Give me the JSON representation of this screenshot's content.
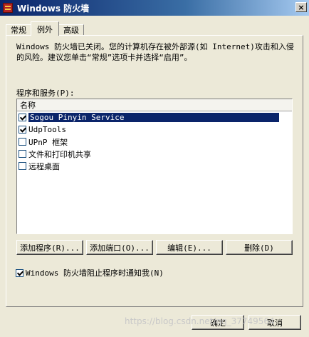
{
  "window": {
    "title": "Windows 防火墙",
    "close_glyph": "×"
  },
  "tabs": [
    {
      "label": "常规",
      "active": false
    },
    {
      "label": "例外",
      "active": true
    },
    {
      "label": "高级",
      "active": false
    }
  ],
  "description": "Windows 防火墙已关闭。您的计算机存在被外部源(如 Internet)攻击和入侵的风险。建议您单击“常规”选项卡并选择“启用”。",
  "programs": {
    "label": "程序和服务(P):",
    "column_header": "名称",
    "items": [
      {
        "label": "Sogou Pinyin Service",
        "checked": true,
        "selected": true
      },
      {
        "label": "UdpTools",
        "checked": true,
        "selected": false
      },
      {
        "label": "UPnP 框架",
        "checked": false,
        "selected": false
      },
      {
        "label": "文件和打印机共享",
        "checked": false,
        "selected": false
      },
      {
        "label": "远程桌面",
        "checked": false,
        "selected": false
      }
    ]
  },
  "buttons": {
    "add_program": "添加程序(R)...",
    "add_port": "添加端口(O)...",
    "edit": "编辑(E)...",
    "delete": "删除(D)",
    "ok": "确定",
    "cancel": "取消"
  },
  "notify": {
    "label": "Windows 防火墙阻止程序时通知我(N)",
    "checked": true
  },
  "watermark": "https://blog.csdn.net/qq_37749564"
}
